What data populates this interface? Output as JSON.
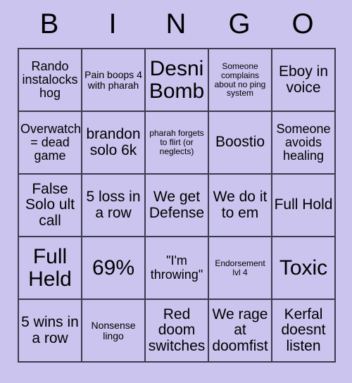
{
  "card": {
    "header_letters": [
      "B",
      "I",
      "N",
      "G",
      "O"
    ],
    "background_color": "#cac4ee",
    "cell_border_color": "#3b3b4f",
    "text_color": "#000000",
    "rows": [
      [
        {
          "text": "Rando instalocks hog",
          "size": "m"
        },
        {
          "text": "Pain boops 4 with pharah",
          "size": "s"
        },
        {
          "text": "Desni Bomb",
          "size": "xxl"
        },
        {
          "text": "Someone complains about no ping system",
          "size": "xs"
        },
        {
          "text": "Eboy in voice",
          "size": "l"
        }
      ],
      [
        {
          "text": "Overwatch = dead game",
          "size": "m"
        },
        {
          "text": "brandon solo 6k",
          "size": "l"
        },
        {
          "text": "pharah forgets to flirt (or neglects)",
          "size": "xs"
        },
        {
          "text": "Boostio",
          "size": "l"
        },
        {
          "text": "Someone avoids healing",
          "size": "m"
        }
      ],
      [
        {
          "text": "False Solo ult call",
          "size": "l"
        },
        {
          "text": "5 loss in a row",
          "size": "l"
        },
        {
          "text": "We get Defense",
          "size": "l"
        },
        {
          "text": "We do it to em",
          "size": "l"
        },
        {
          "text": "Full Hold",
          "size": "l"
        }
      ],
      [
        {
          "text": "Full Held",
          "size": "xxl"
        },
        {
          "text": "69%",
          "size": "xxl"
        },
        {
          "text": "\"I'm throwing\"",
          "size": "m"
        },
        {
          "text": "Endorsement lvl 4",
          "size": "xs"
        },
        {
          "text": "Toxic",
          "size": "xxl"
        }
      ],
      [
        {
          "text": "5 wins in a row",
          "size": "l"
        },
        {
          "text": "Nonsense lingo",
          "size": "s"
        },
        {
          "text": "Red doom switches",
          "size": "l"
        },
        {
          "text": "We rage at doomfist",
          "size": "l"
        },
        {
          "text": "Kerfal doesnt listen",
          "size": "l"
        }
      ]
    ]
  }
}
